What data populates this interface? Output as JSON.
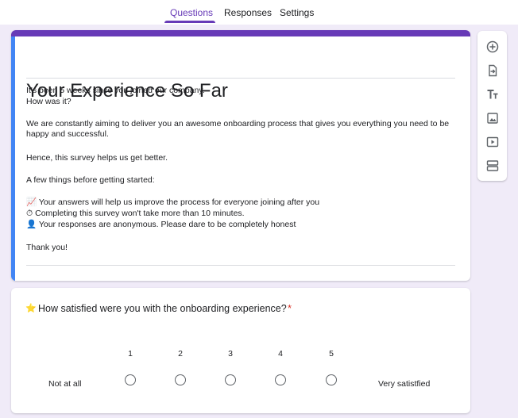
{
  "tabs": [
    {
      "label": "Questions",
      "active": true
    },
    {
      "label": "Responses",
      "active": false
    },
    {
      "label": "Settings",
      "active": false
    }
  ],
  "form": {
    "title": "Your Experience So Far",
    "description": {
      "line1": "It's been 5 weeks since you joined our company.",
      "line2": "How was it?",
      "line3": "We are constantly aiming to deliver you an awesome onboarding process that gives you everything you need to be happy and successful.",
      "line4": "Hence, this survey helps us get better.",
      "line5": "A few things before getting started:",
      "bullet1_icon": "📈",
      "bullet1": "Your answers will help us improve the process for everyone joining after you",
      "bullet2_icon": "⏱",
      "bullet2": "Completing this survey won't take more than 10 minutes.",
      "bullet3_icon": "👤",
      "bullet3": "Your responses are anonymous. Please dare to be completely honest",
      "closing": "Thank you!"
    }
  },
  "question": {
    "emoji": "⭐",
    "text": "How satisfied were you with the onboarding experience?",
    "required_marker": "*",
    "scale": [
      "1",
      "2",
      "3",
      "4",
      "5"
    ],
    "low_label": "Not at all",
    "high_label": "Very satistfied"
  },
  "toolbar": {
    "icons": [
      "add-question-icon",
      "import-questions-icon",
      "add-title-icon",
      "add-image-icon",
      "add-video-icon",
      "add-section-icon"
    ]
  },
  "colors": {
    "accent": "#673ab7",
    "background": "#f0ebf8",
    "focus_accent": "#4285f4",
    "required": "#d93025"
  }
}
